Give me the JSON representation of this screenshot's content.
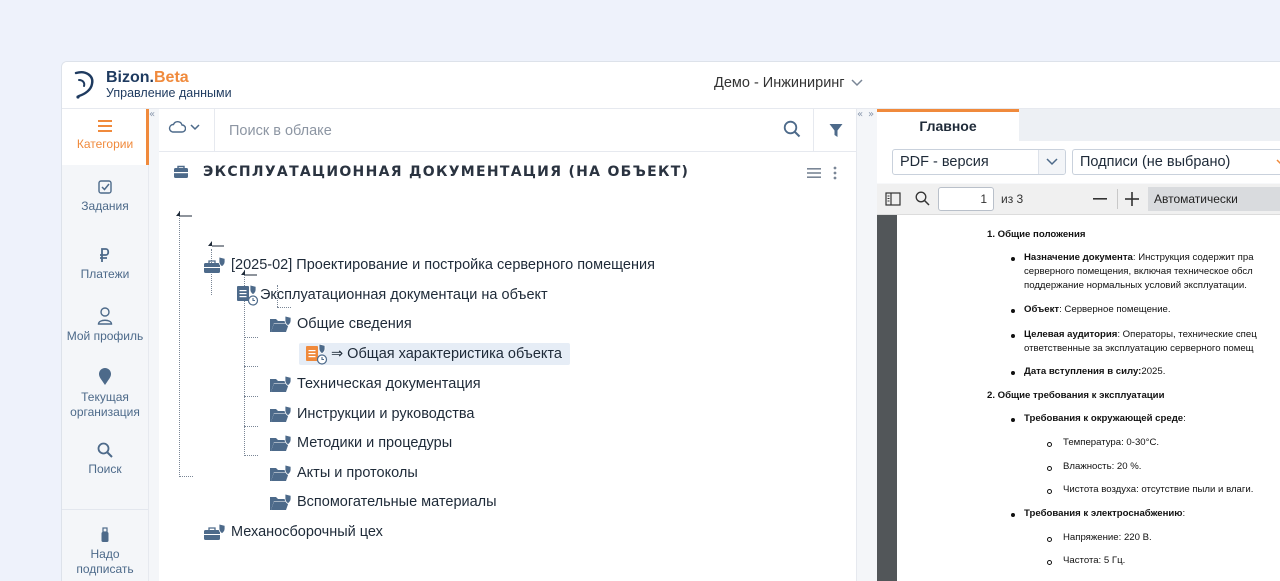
{
  "app": {
    "brand_main": "Bizon.",
    "brand_accent": "Beta",
    "subtitle": "Управление данными",
    "org": "Демо - Инжиниринг"
  },
  "colors": {
    "accent": "#f08a3c",
    "nav_text": "#4d6a8a",
    "brand": "#1e3a5f"
  },
  "nav": {
    "categories": "Категории",
    "tasks": "Задания",
    "payments": "Платежи",
    "profile": "Мой профиль",
    "org_line1": "Текущая",
    "org_line2": "организация",
    "search": "Поиск",
    "sign_line1": "Надо",
    "sign_line2": "подписать"
  },
  "search": {
    "placeholder": "Поиск в облаке"
  },
  "section": {
    "title": "ЭКСПЛУАТАЦИОННАЯ ДОКУМЕНТАЦИЯ (НА ОБЪЕКТ)"
  },
  "tree": {
    "project": "[2025-02] Проектирование и постройка серверного помещения",
    "docs": "Эксплуатационная документаци на объект",
    "general": "Общие сведения",
    "general_item": "⇒ Общая характеристика объекта",
    "tech": "Техническая документация",
    "instructions": "Инструкции и руководства",
    "methods": "Методики и процедуры",
    "acts": "Акты и протоколы",
    "aux": "Вспомогательные материалы",
    "workshop": "Механосборочный цех"
  },
  "viewer": {
    "tab_main": "Главное",
    "format_select": "PDF - версия",
    "sign_select": "Подписи (не выбрано)",
    "page": "1",
    "of_pages": "из 3",
    "zoom": "Автоматически"
  },
  "pdf": {
    "h1": "1. Общие положения",
    "b1_bold": "Назначение документа",
    "b1_rest": ": Инструкция содержит пра",
    "b1_l2": "серверного помещения, включая техническое обсл",
    "b1_l3": "поддержание нормальных условий эксплуатации.",
    "b2_bold": "Объект",
    "b2_rest": ": Серверное помещение.",
    "b3_bold": "Целевая аудитория",
    "b3_rest": ": Операторы, технические спец",
    "b3_l2": "ответственные за эксплуатацию серверного помещ",
    "b4_bold": "Дата вступления в силу:",
    "b4_rest": "2025.",
    "h2": "2. Общие требования к эксплуатации",
    "b5_bold": "Требования к окружающей среде",
    "b5_rest": ":",
    "s1": "Температура: 0-30°C.",
    "s2": "Влажность: 20 %.",
    "s3": "Чистота воздуха: отсутствие пыли и влаги.",
    "b6_bold": "Требования к электроснабжению",
    "b6_rest": ":",
    "s4": "Напряжение: 220 В.",
    "s5": "Частота: 5 Гц."
  }
}
